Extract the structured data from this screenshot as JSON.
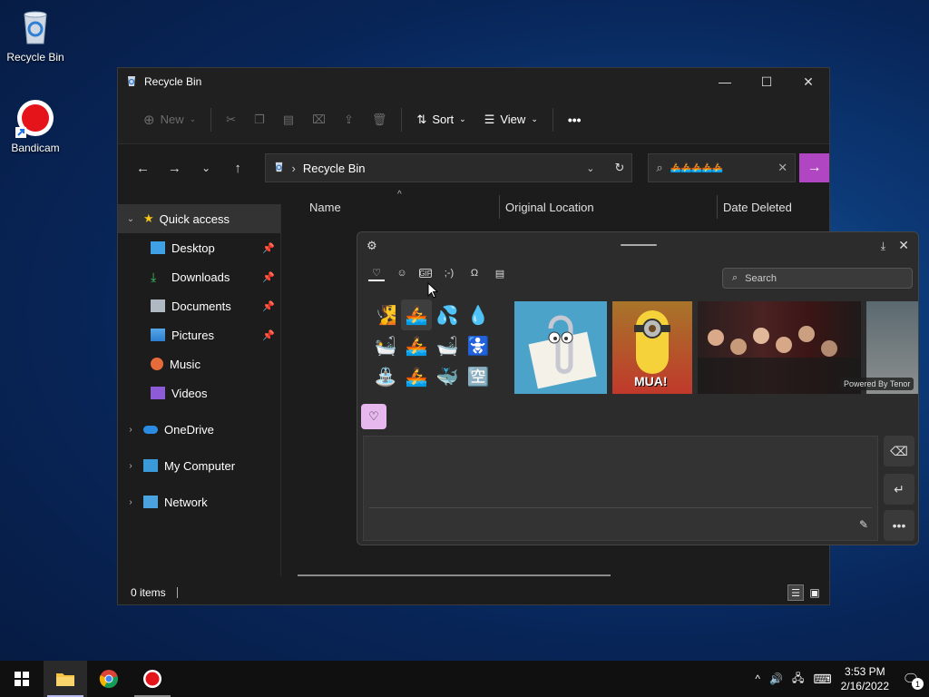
{
  "desktop": {
    "icons": [
      {
        "label": "Recycle Bin"
      },
      {
        "label": "Bandicam"
      }
    ]
  },
  "explorer": {
    "title": "Recycle Bin",
    "toolbar": {
      "new_label": "New",
      "sort_label": "Sort",
      "view_label": "View",
      "more_label": "•••"
    },
    "address": {
      "path": "Recycle Bin"
    },
    "search": {
      "value": "🚣🚣🚣🚣🚣"
    },
    "sidebar": {
      "quick_access": "Quick access",
      "items": [
        {
          "label": "Desktop",
          "pinned": true
        },
        {
          "label": "Downloads",
          "pinned": true
        },
        {
          "label": "Documents",
          "pinned": true
        },
        {
          "label": "Pictures",
          "pinned": true
        },
        {
          "label": "Music",
          "pinned": false
        },
        {
          "label": "Videos",
          "pinned": false
        }
      ],
      "onedrive": "OneDrive",
      "my_computer": "My Computer",
      "network": "Network"
    },
    "columns": [
      "Name",
      "Original Location",
      "Date Deleted"
    ],
    "status": "0 items"
  },
  "emoji_panel": {
    "search_placeholder": "Search",
    "emojis": [
      "🧏",
      "🚣",
      "💦",
      "💧",
      "🛀",
      "🚣",
      "🛁",
      "🚼",
      "⛲",
      "🚣",
      "🐳",
      "🈳"
    ],
    "gifs": [
      {
        "label": ""
      },
      {
        "label": "MUA!"
      },
      {
        "label": ""
      },
      {
        "label": ""
      }
    ],
    "powered_by": "Powered By Tenor"
  },
  "taskbar": {
    "time": "3:53 PM",
    "date": "2/16/2022",
    "notification_count": "1"
  },
  "colors": {
    "accent": "#b146c2",
    "recent_tile": "#e7b8ee"
  }
}
